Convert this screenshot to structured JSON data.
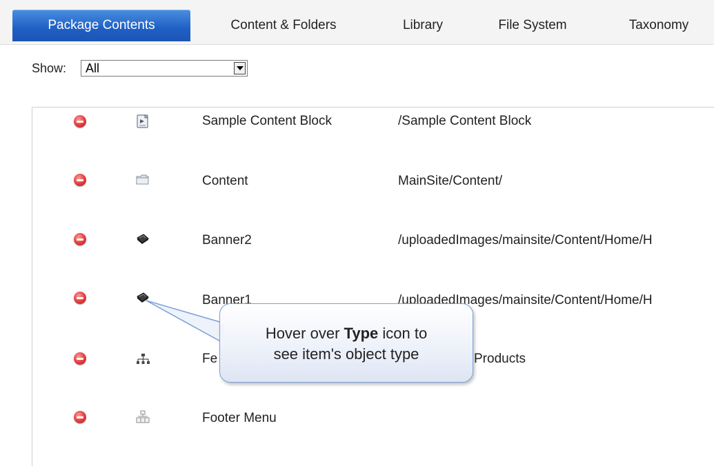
{
  "tabs": [
    {
      "label": "Package Contents",
      "active": true
    },
    {
      "label": "Content & Folders"
    },
    {
      "label": "Library"
    },
    {
      "label": "File System"
    },
    {
      "label": "Taxonomy"
    }
  ],
  "filter": {
    "label": "Show:",
    "selected": "All"
  },
  "items": [
    {
      "name": "Sample Content Block",
      "path": "/Sample Content Block",
      "type_icon": "content-block-icon"
    },
    {
      "name": "Content",
      "path": "MainSite/Content/",
      "type_icon": "folder-icon"
    },
    {
      "name": "Banner2",
      "path": "/uploadedImages/mainsite/Content/Home/H",
      "type_icon": "library-image-icon"
    },
    {
      "name": "Banner1",
      "path": "/uploadedImages/mainsite/Content/Home/H",
      "type_icon": "library-image-icon"
    },
    {
      "name": "Fe",
      "path": "Products",
      "type_icon": "taxonomy-icon"
    },
    {
      "name": "Footer Menu",
      "path": "",
      "type_icon": "menu-icon"
    }
  ],
  "callout": {
    "before": "Hover over ",
    "bold": "Type",
    "after": " icon to",
    "line2": "see item's object type"
  },
  "colors": {
    "tab_active": "#1f5fc4",
    "remove": "#e03b3b",
    "callout_border": "#7aa0d8"
  }
}
